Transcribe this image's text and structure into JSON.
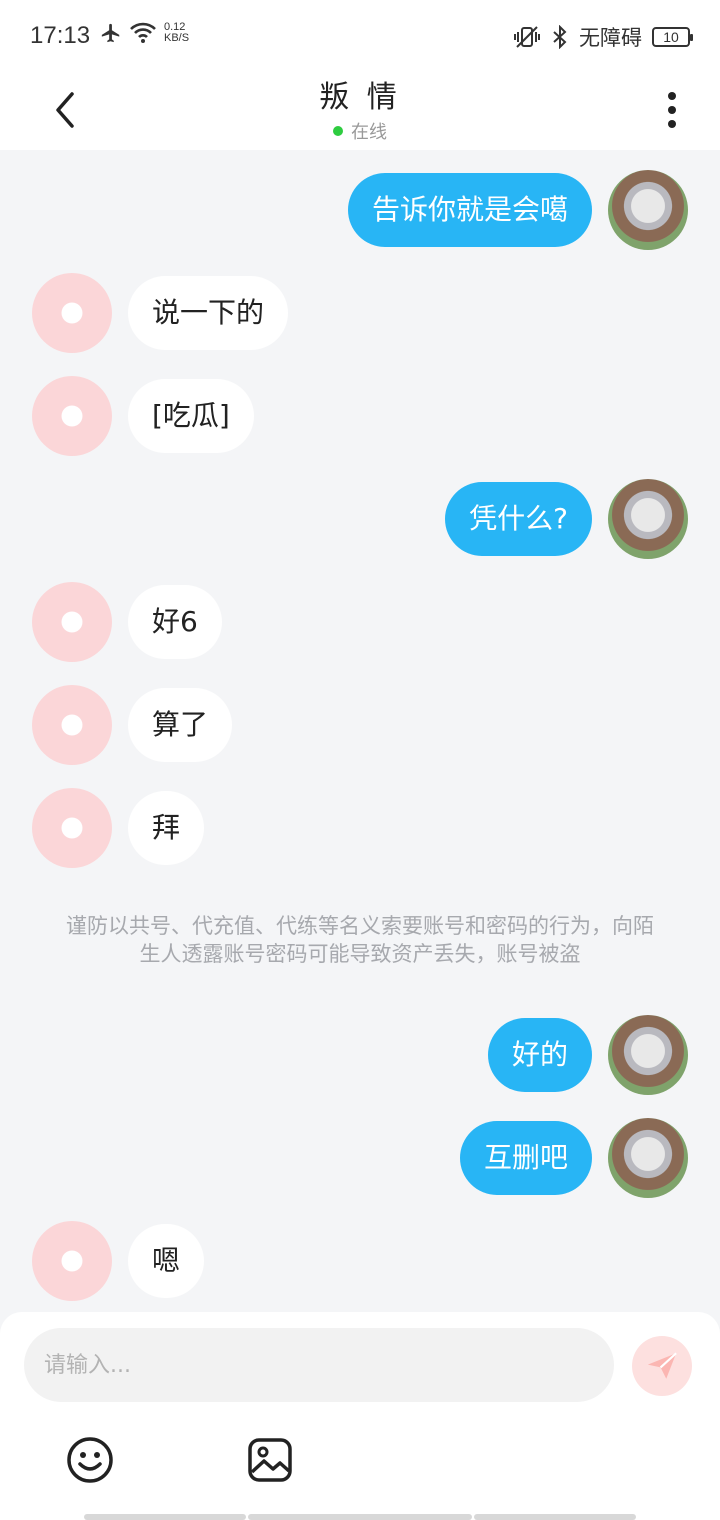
{
  "status_bar": {
    "time": "17:13",
    "speed_value": "0.12",
    "speed_unit": "KB/S",
    "accessibility_label": "无障碍",
    "battery": "10"
  },
  "header": {
    "title": "叛 情",
    "status": "在线",
    "online_color": "#2ecc40"
  },
  "messages": [
    {
      "from": "me",
      "text": "告诉你就是会噶"
    },
    {
      "from": "other",
      "text": "说一下的"
    },
    {
      "from": "other",
      "text": "[吃瓜]"
    },
    {
      "from": "me",
      "text": "凭什么?"
    },
    {
      "from": "other",
      "text": "好6"
    },
    {
      "from": "other",
      "text": "算了"
    },
    {
      "from": "other",
      "text": "拜"
    },
    {
      "from": "me",
      "text": "好的"
    },
    {
      "from": "me",
      "text": "互删吧"
    },
    {
      "from": "other",
      "text": "嗯"
    }
  ],
  "notice": "谨防以共号、代充值、代练等名义索要账号和密码的行为，向陌生人透露账号密码可能导致资产丢失，账号被盗",
  "input": {
    "placeholder": "请输入..."
  },
  "icons": {
    "back": "back-arrow-icon",
    "more": "more-vertical-icon",
    "send": "paper-plane-icon",
    "emoji": "smiley-icon",
    "image": "image-icon"
  },
  "colors": {
    "my_bubble": "#28b5f5",
    "other_bubble": "#ffffff",
    "background": "#f4f5f7",
    "send_button": "#fde0df"
  }
}
